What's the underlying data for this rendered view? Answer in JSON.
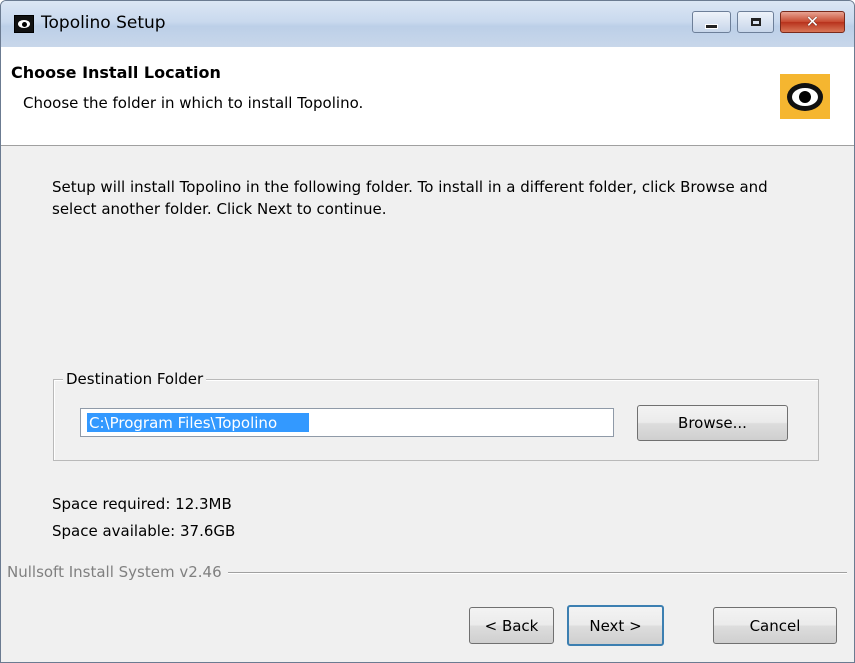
{
  "window": {
    "title": "Topolino Setup",
    "app_icon": "eye-icon"
  },
  "header": {
    "title": "Choose Install Location",
    "subtitle": "Choose the folder in which to install Topolino.",
    "logo_icon": "eye-logo-icon"
  },
  "body": {
    "description": "Setup will install Topolino in the following folder. To install in a different folder, click Browse and select another folder. Click Next to continue."
  },
  "destination": {
    "group_label": "Destination Folder",
    "path": "C:\\Program Files\\Topolino",
    "browse_label": "Browse..."
  },
  "space": {
    "required": "Space required: 12.3MB",
    "available": "Space available: 37.6GB"
  },
  "branding": {
    "text": "Nullsoft Install System v2.46"
  },
  "buttons": {
    "back": "< Back",
    "next": "Next >",
    "cancel": "Cancel"
  },
  "colors": {
    "selection": "#3399ff",
    "logo_bg": "#f5b630",
    "close_button": "#c7492f"
  }
}
